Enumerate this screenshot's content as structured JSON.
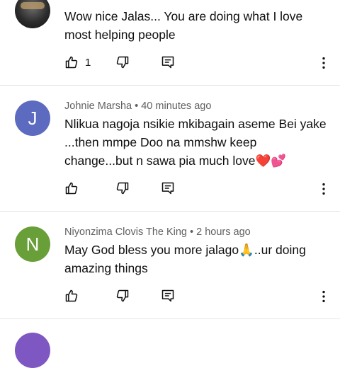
{
  "comments": [
    {
      "meta": "",
      "text": "Wow nice Jalas... You are doing what I love most helping people",
      "likes": "1"
    },
    {
      "avatar_letter": "J",
      "avatar_color": "#5c6bc0",
      "meta": "Johnie Marsha • 40 minutes ago",
      "text": "Nlikua nagoja nsikie mkibagain aseme Bei yake ...then mmpe Doo na mmshw keep change...but n sawa pia much love❤️💕",
      "likes": ""
    },
    {
      "avatar_letter": "N",
      "avatar_color": "#689f38",
      "meta": "Niyonzima Clovis The King • 2 hours ago",
      "text": "May God bless you more jalago🙏..ur doing amazing things",
      "likes": ""
    },
    {
      "avatar_letter": "",
      "avatar_color": "#7e57c2",
      "meta": "",
      "text": "",
      "likes": ""
    }
  ],
  "icons": {
    "like": "thumb-up-icon",
    "dislike": "thumb-down-icon",
    "reply": "reply-icon",
    "more": "more-vert-icon"
  },
  "colors": {
    "meta_text": "#606060",
    "divider": "#e5e5e5"
  }
}
